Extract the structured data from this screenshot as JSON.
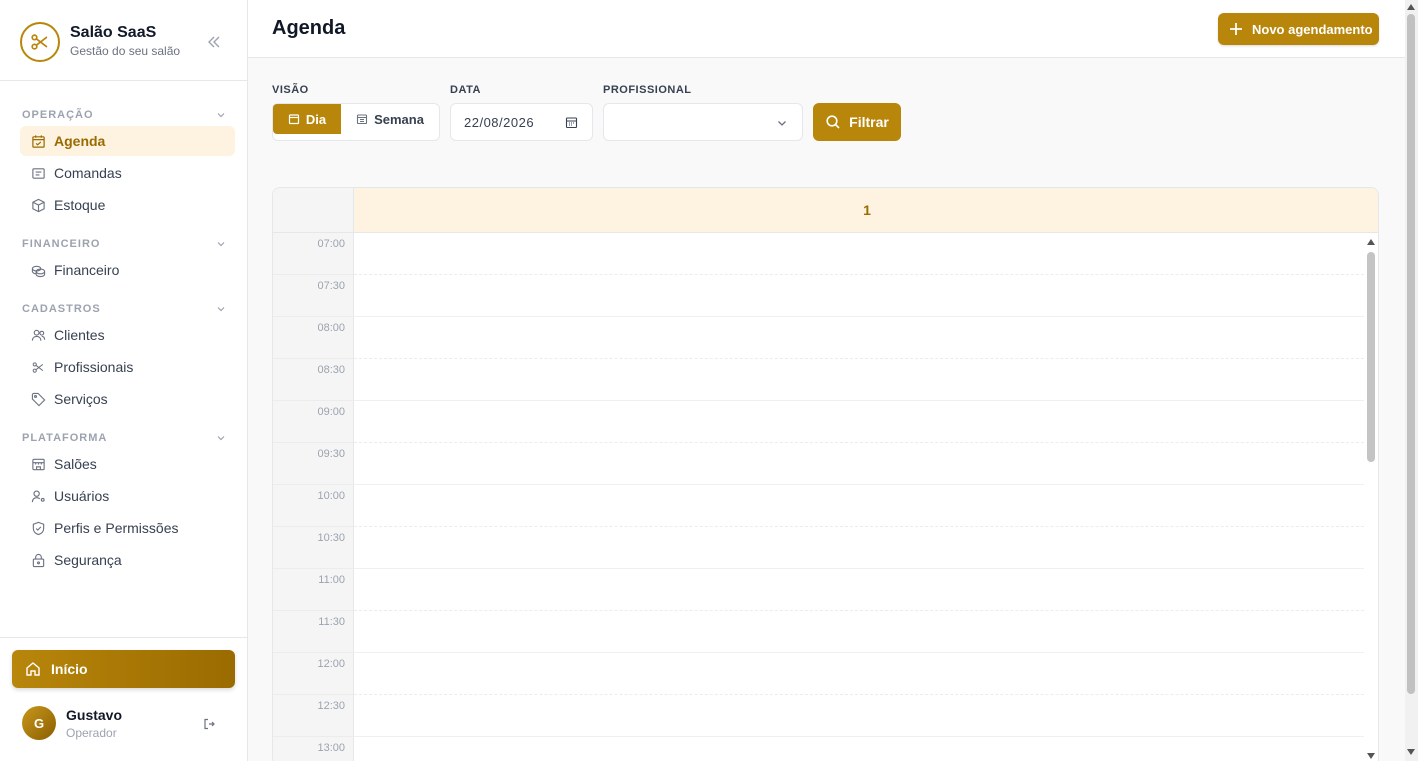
{
  "brand": {
    "title": "Salão SaaS",
    "subtitle": "Gestão do seu salão"
  },
  "sidebar": {
    "sections": [
      {
        "label": "OPERAÇÃO",
        "items": [
          {
            "label": "Agenda",
            "icon": "calendar-icon",
            "active": true
          },
          {
            "label": "Comandas",
            "icon": "receipt-icon"
          },
          {
            "label": "Estoque",
            "icon": "box-icon"
          }
        ]
      },
      {
        "label": "FINANCEIRO",
        "items": [
          {
            "label": "Financeiro",
            "icon": "coins-icon"
          }
        ]
      },
      {
        "label": "CADASTROS",
        "items": [
          {
            "label": "Clientes",
            "icon": "users-icon"
          },
          {
            "label": "Profissionais",
            "icon": "scissors-icon"
          },
          {
            "label": "Serviços",
            "icon": "tag-icon"
          }
        ]
      },
      {
        "label": "PLATAFORMA",
        "items": [
          {
            "label": "Salões",
            "icon": "store-icon"
          },
          {
            "label": "Usuários",
            "icon": "user-cog-icon"
          },
          {
            "label": "Perfis e Permissões",
            "icon": "shield-icon"
          },
          {
            "label": "Segurança",
            "icon": "lock-icon"
          }
        ]
      }
    ],
    "home_label": "Início",
    "user": {
      "initial": "G",
      "name": "Gustavo",
      "role": "Operador"
    }
  },
  "header": {
    "title": "Agenda",
    "new_button": "Novo agendamento"
  },
  "filters": {
    "view_label": "VISÃO",
    "view_day": "Dia",
    "view_week": "Semana",
    "date_label": "DATA",
    "date_value": "22/08/2026",
    "professional_label": "PROFISSIONAL",
    "professional_value": "",
    "filter_button": "Filtrar"
  },
  "calendar": {
    "column_header": "1",
    "times": [
      "07:00",
      "07:30",
      "08:00",
      "08:30",
      "09:00",
      "09:30",
      "10:00",
      "10:30",
      "11:00",
      "11:30",
      "12:00",
      "12:30",
      "13:00"
    ]
  },
  "colors": {
    "accent": "#b8860b",
    "accent_light": "#fdf3e0",
    "accent_text": "#9a6b00"
  }
}
